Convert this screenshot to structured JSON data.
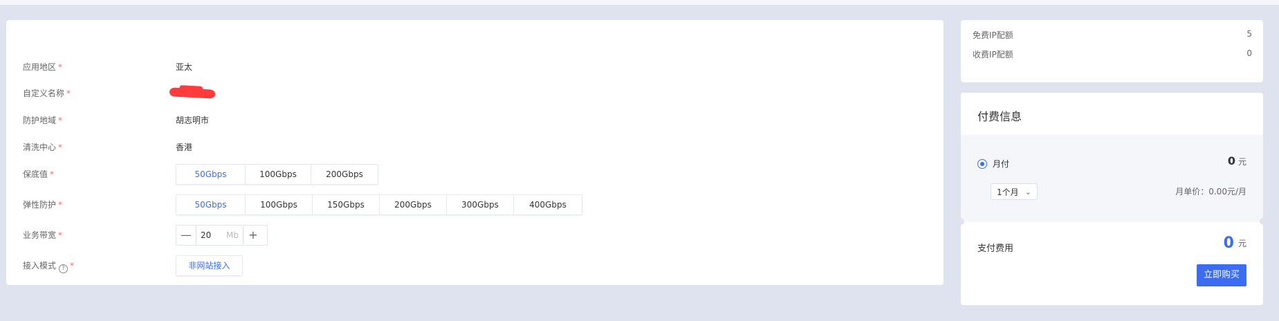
{
  "form": {
    "region": {
      "label": "应用地区",
      "req": "*",
      "value": "亚太"
    },
    "custom_name": {
      "label": "自定义名称",
      "req": "*",
      "value": ""
    },
    "protect_area": {
      "label": "防护地域",
      "req": "*",
      "value": "胡志明市"
    },
    "scrub_center": {
      "label": "清洗中心",
      "req": "*",
      "value": "香港"
    },
    "base_protect": {
      "label": "保底值",
      "req": "*",
      "options": [
        "50Gbps",
        "100Gbps",
        "200Gbps"
      ],
      "selected": "50Gbps"
    },
    "elastic_protect": {
      "label": "弹性防护",
      "req": "*",
      "options": [
        "50Gbps",
        "100Gbps",
        "150Gbps",
        "200Gbps",
        "300Gbps",
        "400Gbps"
      ],
      "selected": "50Gbps"
    },
    "bandwidth": {
      "label": "业务带宽",
      "req": "*",
      "minus": "—",
      "value": "20",
      "unit": "Mb",
      "plus": "+"
    },
    "access_mode": {
      "label": "接入模式",
      "help": "?",
      "req": "*",
      "value": "非网站接入"
    }
  },
  "quota": {
    "free_ip": {
      "label": "免费IP配额",
      "value": "5"
    },
    "paid_ip": {
      "label": "收费IP配额",
      "value": "0"
    }
  },
  "pay": {
    "title": "付费信息",
    "monthly_label": "月付",
    "monthly_amount": "0",
    "currency": "元",
    "duration": "1个月",
    "unit_price": "月单价：0.00元/月",
    "fee_label": "支付费用",
    "fee_amount": "0",
    "buy_label": "立即购买"
  },
  "colors": {
    "accent": "#3c6df0",
    "required": "#f56c6c",
    "page_bg": "#dfe3ef"
  }
}
